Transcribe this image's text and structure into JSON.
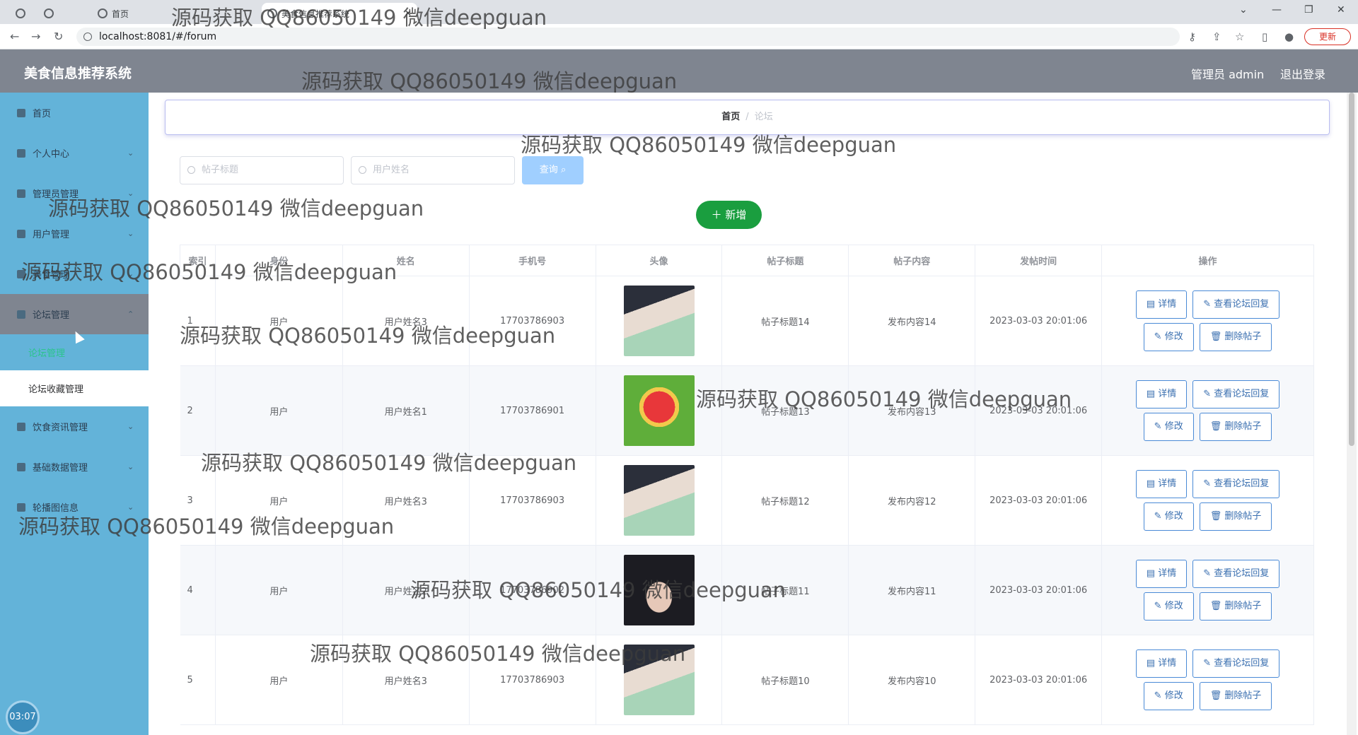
{
  "browser": {
    "tabs": [
      {
        "label": ""
      },
      {
        "label": ""
      },
      {
        "label": "首页"
      },
      {
        "label": "美食信息推荐系统"
      }
    ],
    "url": "localhost:8081/#/forum",
    "update_label": "更新"
  },
  "header": {
    "title": "美食信息推荐系统",
    "user": "管理员 admin",
    "logout": "退出登录"
  },
  "sidebar": {
    "items": [
      {
        "label": "首页"
      },
      {
        "label": "个人中心"
      },
      {
        "label": "管理员管理"
      },
      {
        "label": "用户管理"
      },
      {
        "label": "美食管理"
      },
      {
        "label": "论坛管理"
      },
      {
        "label": "饮食资讯管理"
      },
      {
        "label": "基础数据管理"
      },
      {
        "label": "轮播图信息"
      }
    ],
    "submenu": [
      {
        "label": "论坛管理"
      },
      {
        "label": "论坛收藏管理"
      }
    ],
    "timer": "03:07"
  },
  "breadcrumb": {
    "home": "首页",
    "current": "论坛"
  },
  "search": {
    "title_placeholder": "帖子标题",
    "name_placeholder": "用户姓名",
    "query_label": "查询"
  },
  "add_label": "新增",
  "table": {
    "columns": [
      "索引",
      "身份",
      "姓名",
      "手机号",
      "头像",
      "帖子标题",
      "帖子内容",
      "发帖时间",
      "操作"
    ],
    "rows": [
      {
        "index": "1",
        "role": "用户",
        "name": "用户姓名3",
        "phone": "17703786903",
        "title": "帖子标题14",
        "content": "发布内容14",
        "time": "2023-03-03 20:01:06"
      },
      {
        "index": "2",
        "role": "用户",
        "name": "用户姓名1",
        "phone": "17703786901",
        "title": "帖子标题13",
        "content": "发布内容13",
        "time": "2023-03-03 20:01:06"
      },
      {
        "index": "3",
        "role": "用户",
        "name": "用户姓名3",
        "phone": "17703786903",
        "title": "帖子标题12",
        "content": "发布内容12",
        "time": "2023-03-03 20:01:06"
      },
      {
        "index": "4",
        "role": "用户",
        "name": "用户姓名2",
        "phone": "17703786902",
        "title": "帖子标题11",
        "content": "发布内容11",
        "time": "2023-03-03 20:01:06"
      },
      {
        "index": "5",
        "role": "用户",
        "name": "用户姓名3",
        "phone": "17703786903",
        "title": "帖子标题10",
        "content": "发布内容10",
        "time": "2023-03-03 20:01:06"
      }
    ],
    "actions": {
      "detail": "详情",
      "replies": "查看论坛回复",
      "edit": "修改",
      "delete": "删除帖子"
    }
  },
  "watermark": "源码获取 QQ86050149 微信deepguan",
  "colors": {
    "header_bg": "#7f8590",
    "sidebar_bg": "#63b3d9",
    "add_button": "#1a9e3f",
    "query_button": "#a0cfff",
    "active_submenu": "#2bc48c"
  }
}
